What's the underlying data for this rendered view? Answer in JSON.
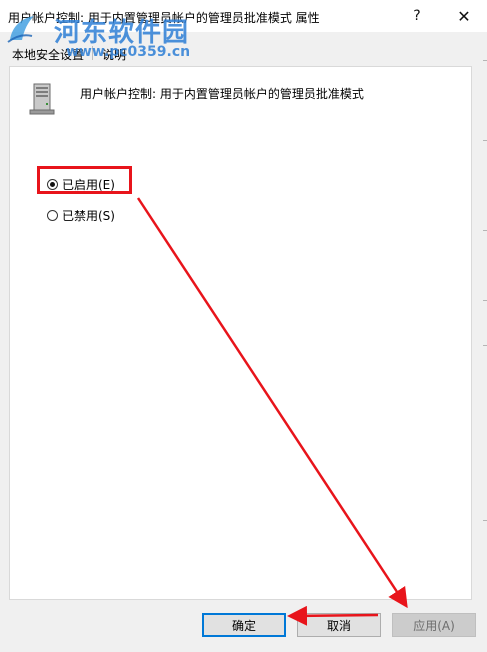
{
  "window": {
    "title": "用户帐户控制: 用于内置管理员帐户的管理员批准模式 属性",
    "help_label": "?",
    "close_label": "✕"
  },
  "watermark": {
    "site_name": "河东软件园",
    "url": "www.pc0359.cn"
  },
  "tabs": [
    {
      "label": "本地安全设置",
      "selected": true
    },
    {
      "label": "说明",
      "selected": false
    }
  ],
  "policy": {
    "icon": "server-computer-icon",
    "title": "用户帐户控制: 用于内置管理员帐户的管理员批准模式"
  },
  "options": [
    {
      "label": "已启用(E)",
      "checked": true
    },
    {
      "label": "已禁用(S)",
      "checked": false
    }
  ],
  "buttons": {
    "ok": "确定",
    "cancel": "取消",
    "apply": "应用(A)"
  },
  "colors": {
    "annotation_red": "#e8141b",
    "focus_blue": "#0078d7",
    "watermark_blue": "#2e7fd6"
  }
}
